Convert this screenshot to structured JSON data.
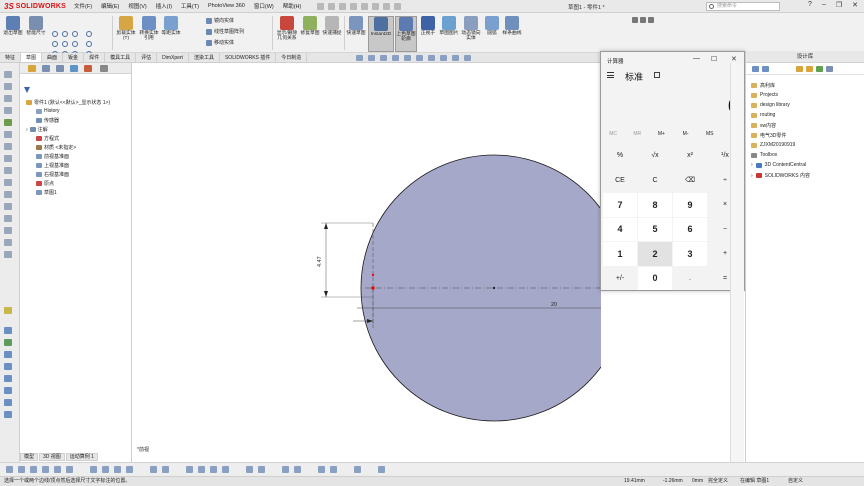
{
  "app": {
    "brand_ds": "3S",
    "brand_name": "SOLIDWORKS",
    "doc_title": "草图1 - 零件1 *",
    "search_placeholder": "搜索命令"
  },
  "menu": [
    "文件(F)",
    "编辑(E)",
    "视图(V)",
    "插入(I)",
    "工具(T)",
    "PhotoView 360",
    "窗口(W)",
    "帮助(H)"
  ],
  "ribbon": {
    "exit_sketch": "退出草图",
    "smart_dim": "智能尺寸",
    "trim": "剪裁实体(T)",
    "convert": "转换实体引用",
    "offset": "等距实体",
    "mirror": "镜向实体",
    "linear_pattern": "线性草图阵列",
    "move": "移动实体",
    "display_delete": "显示/删除几何关系",
    "repair": "修复草图",
    "quick_snap": "快速捕捉",
    "rapid_sketch": "快速草图",
    "instant2d": "Instant2D",
    "shaded_contour": "上色草图轮廓",
    "normal_to": "正视于",
    "sketch_picture": "草图图片",
    "dynamic_mirror": "动态镜向实体",
    "curve": "圆弧",
    "spline": "样条曲线"
  },
  "tabs": [
    "特征",
    "草图",
    "曲面",
    "钣金",
    "焊件",
    "模具工具",
    "评估",
    "DimXpert",
    "渲染工具",
    "SOLIDWORKS 插件",
    "今日制造"
  ],
  "tree": {
    "root": "零件1 (默认<<默认>_显示状态 1>)",
    "items": [
      "History",
      "传感器",
      "注解",
      "方程式",
      "材质 <未指定>",
      "前视基准面",
      "上视基准面",
      "右视基准面",
      "原点",
      "草图1"
    ]
  },
  "calculator": {
    "title": "计算器",
    "mode": "标准",
    "display": "0",
    "memory": [
      "MC",
      "MR",
      "M+",
      "M-",
      "MS",
      "M˅"
    ],
    "keys": [
      "%",
      "√x",
      "x²",
      "¹/x",
      "CE",
      "C",
      "⌫",
      "÷",
      "7",
      "8",
      "9",
      "×",
      "4",
      "5",
      "6",
      "−",
      "1",
      "2",
      "3",
      "+",
      "+/-",
      "0",
      ".",
      "="
    ],
    "controls": {
      "minimize": "—",
      "maximize": "☐",
      "close": "✕"
    }
  },
  "library": {
    "title": "设计库",
    "items": [
      "高利库",
      "Projects",
      "design library",
      "routing",
      "sw内容",
      "电气3D零件",
      "ZJXM20190919",
      "Toolbox",
      "3D ContentCentral",
      "SOLIDWORKS 内容"
    ]
  },
  "sketch": {
    "dim_horizontal": "20",
    "dim_vertical": "4.47"
  },
  "bottom_tabs": [
    "模型",
    "3D 视图",
    "运动算例 1"
  ],
  "view_label": "*前视",
  "status": {
    "message": "选择一个或两个边线/顶点然后选择尺寸文字标注的位置。",
    "x": "19.41mm",
    "y": "-1.26mm",
    "z": "0mm",
    "state": "完全定义",
    "editing": "在编辑 草图1",
    "units": "自定义"
  },
  "colors": {
    "circle_fill": "#a6a8c9",
    "accent": "#3b64a8",
    "brand": "#d11111"
  }
}
